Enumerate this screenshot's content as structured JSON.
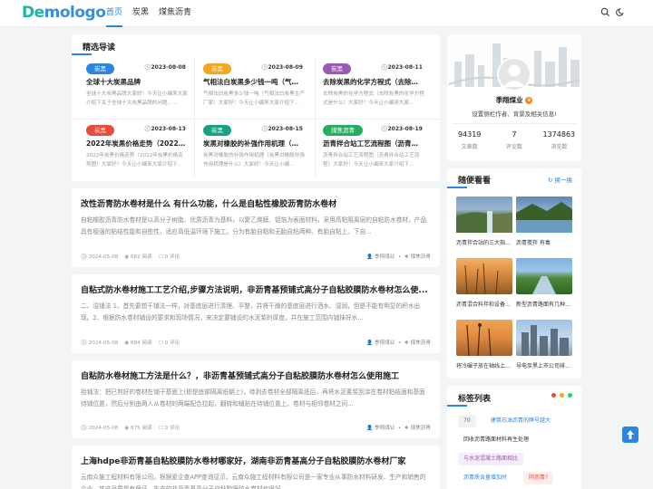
{
  "header": {
    "logo_part1": "De",
    "logo_part2": "mologo",
    "nav": [
      "首页",
      "炭黑",
      "煤焦沥青"
    ],
    "active_nav": 0
  },
  "featured": {
    "title": "精选导读",
    "items": [
      {
        "tag": "炭黑",
        "tag_color": "#2a86e0",
        "date": "2023-08-08",
        "title": "全球十大炭黑品牌",
        "desc": "全球十大炭黑品牌大家好！今天让小编来大家介绍下关于全球十大炭黑品牌的问题，..."
      },
      {
        "tag": "炭黑",
        "tag_color": "#f5a623",
        "date": "2023-08-09",
        "title": "气相法白炭黑多少钱一吨（气相法白炭黑...",
        "desc": "气相法白炭黑多少钱一吨（气相法白炭黑生产厂家）大家好！今天让小编来大家介绍下..."
      },
      {
        "tag": "炭黑",
        "tag_color": "#9b59b6",
        "date": "2023-08-11",
        "title": "去除炭黑的化学方程式（去除炭黑的化学...",
        "desc": "去除炭黑的化学方程式（去除炭黑的化学方程式是什么）大家好！今天让小编来大家..."
      },
      {
        "tag": "炭黑",
        "tag_color": "#e74c3c",
        "date": "2023-08-13",
        "title": "2022年炭黑价格走势（2022年炭黑价格...",
        "desc": "2022年炭黑价格走势（2022年炭黑价格走势图）大家好！今天让小编来大家介绍下..."
      },
      {
        "tag": "炭黑",
        "tag_color": "#16a085",
        "date": "2023-08-15",
        "title": "炭黑对橡胶的补强作用机理（炭黑对橡胶...",
        "desc": "炭黑对橡胶的补强作用机理（炭黑对橡胶补强作用机理是什么）大家好！今天让小编..."
      },
      {
        "tag": "煤焦沥青",
        "tag_color": "#27ae60",
        "date": "2023-08-19",
        "title": "沥青拌合站工艺流程图（沥青拌合站工艺...",
        "desc": "沥青拌合站工艺流程图（沥青拌合站工艺流程）大家好！今天让小编来大家介绍下..."
      }
    ]
  },
  "posts": [
    {
      "title": "改性沥青防水卷材是什么 有什么功能，什么是自粘性橡胶沥青防水卷材",
      "desc": "自粘橡胶沥青防水卷材是以高分子树脂、优质沥青为基料，以聚乙烯膜、铝箔为表面材料，采用高粘阻离层的自粘防水卷材。产品具有极强的粘结性能和自愈性，适应高低温环境下施工。分为有胎自粘和无胎自粘两种。有胎自粘上、下自...",
      "date": "2024-05-08",
      "views": "662 阅读",
      "comments": "0 评论",
      "author": "季翔煤业",
      "category": "煤焦沥青"
    },
    {
      "title": "自粘式防水卷材施工工艺介绍,步骤方法说明，非沥青基预铺式高分子自粘胶膜防水卷材怎么使...",
      "desc": "二、湿铺法 1、首先要想干铺法一样，对基底层进行清理、平整，并将干燥的基底层进行洒水、湿润，但是不能有明显的积水出现。2、根据防水卷材铺设的要求和现场情况，来决定要铺设的水泥浆的厚度，并在施工范围内铺抹好水...",
      "date": "2024-05-08",
      "views": "684 阅读",
      "comments": "0 评论",
      "author": "季翔煤业",
      "category": "煤焦沥青"
    },
    {
      "title": "自粘防水卷材施工方法是什么？，非沥青基预铺式高分子自粘胶膜防水卷材怎么使用施工",
      "desc": "抬铺法：把已剪好的卷材在铺于基面上(即是底部隔离纸朝上)，待剥去卷材全部隔离纸后，再将水泥素浆刮涂在卷材粘结面和基面待铺位置，然后分别由两人从卷材的两端配合拉起，翻转和辅贴在待铺位置上。卷材与相邻卷材之间...",
      "date": "2024-05-08",
      "views": "675 阅读",
      "comments": "0 评论",
      "author": "季翔煤业",
      "category": "煤焦沥青"
    },
    {
      "title": "上海hdpe非沥青基自粘胶膜防水卷材哪家好，湖南非沥青基高分子自粘胶膜防水卷材厂家",
      "desc": "云南众施工程材料有限公司。根据爱企查APP查询显示，云南众施工程材料有限公司是一家专业从事防水材料研发、生产和销售的企业，其产品质量有保证，生产的非沥青基高分子自粘胶膜防水卷材也很好。"
    }
  ],
  "profile": {
    "name": "季翔煤业",
    "bio": "设置侧栏作者、背景及相关信息!",
    "stats": [
      {
        "value": "94319",
        "label": "文章数"
      },
      {
        "value": "7",
        "label": "评论数"
      },
      {
        "value": "1374863",
        "label": "浏览数"
      }
    ]
  },
  "random": {
    "title": "随便看看",
    "refresh": "换一换",
    "items": [
      {
        "caption": "沥青拌合站的三大指标是什么..."
      },
      {
        "caption": "沥青搅拌 有毒"
      },
      {
        "caption": "沥青混合料拌和设备（沥青混合..."
      },
      {
        "caption": "新型沥青路面有几种（新型沥..."
      },
      {
        "caption": "将冷碾子放在轴线上（碾子和..."
      },
      {
        "caption": "导电炭黑上市公司排名（导电..."
      }
    ]
  },
  "tags": {
    "title": "标签列表",
    "items": [
      {
        "text": "70",
        "color": "#666",
        "bg": "#f2f2f2"
      },
      {
        "text": "建筑石油沥青的牌号越大",
        "color": "#2a86e0",
        "bg": "#fff"
      },
      {
        "text": "回收沥青路面材料再生处理",
        "color": "#333",
        "bg": "#fff"
      },
      {
        "text": "与水泥混凝土路面相比",
        "color": "#9b59b6",
        "bg": "#f5eefa"
      },
      {
        "text": "沥青质含量增加时",
        "color": "#2a86e0",
        "bg": "#fff"
      },
      {
        "text": "阴沥青?",
        "color": "#e74c3c",
        "bg": "#fdeeee"
      }
    ]
  }
}
